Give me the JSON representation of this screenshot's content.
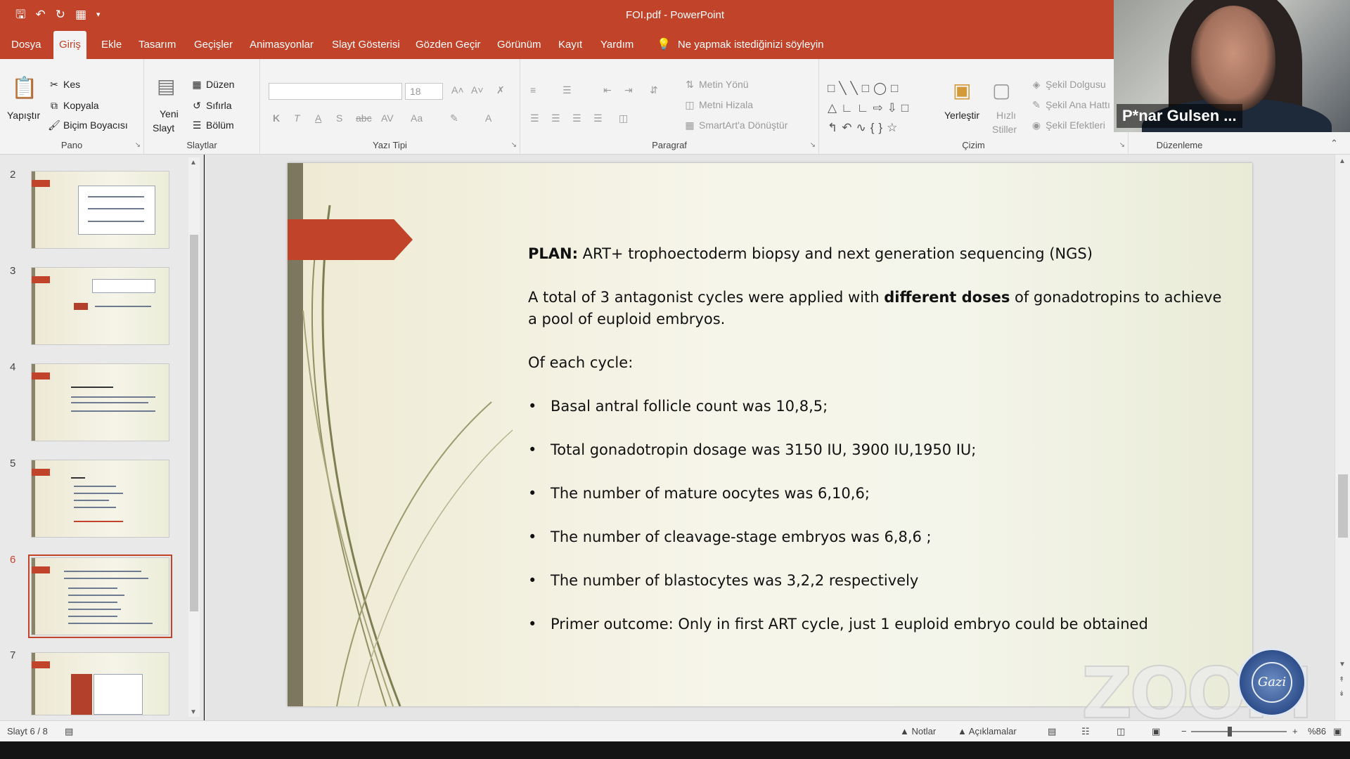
{
  "window": {
    "title": "FOI.pdf  -  PowerPoint",
    "qat_icons": [
      "save-icon",
      "undo-icon",
      "redo-icon",
      "present-icon",
      "customize-icon"
    ]
  },
  "tabs": [
    "Dosya",
    "Giriş",
    "Ekle",
    "Tasarım",
    "Geçişler",
    "Animasyonlar",
    "Slayt Gösterisi",
    "Gözden Geçir",
    "Görünüm",
    "Kayıt",
    "Yardım"
  ],
  "active_tab": "Giriş",
  "tell_me": "Ne yapmak istediğinizi söyleyin",
  "ribbon": {
    "pano": {
      "label": "Pano",
      "paste": "Yapıştır",
      "cut": "Kes",
      "copy": "Kopyala",
      "format_painter": "Biçim Boyacısı"
    },
    "slaytlar": {
      "label": "Slaytlar",
      "new_slide_line1": "Yeni",
      "new_slide_line2": "Slayt",
      "layout": "Düzen",
      "reset": "Sıfırla",
      "section": "Bölüm"
    },
    "yazi_tipi": {
      "label": "Yazı Tipi",
      "font_size": "18",
      "bold": "K",
      "italic": "T",
      "underline": "A",
      "strike": "S",
      "abc": "abc",
      "spacing": "AV",
      "case": "Aa",
      "color": "A"
    },
    "paragraf": {
      "label": "Paragraf",
      "text_direction": "Metin Yönü",
      "align_text": "Metni Hizala",
      "smartart": "SmartArt'a Dönüştür"
    },
    "cizim": {
      "label": "Çizim",
      "arrange": "Yerleştir",
      "quick_styles_line1": "Hızlı",
      "quick_styles_line2": "Stiller",
      "shape_fill": "Şekil Dolgusu",
      "shape_outline": "Şekil Ana Hattı",
      "shape_effects": "Şekil Efektleri"
    },
    "duzenleme": {
      "label": "Düzenleme"
    }
  },
  "video": {
    "name": "P*nar Gulsen ..."
  },
  "thumbnails": {
    "numbers": [
      "2",
      "3",
      "4",
      "5",
      "6",
      "7"
    ],
    "selected": "6"
  },
  "slide": {
    "plan_label": "PLAN:",
    "plan_text": " ART+ trophoectoderm biopsy and next generation sequencing (NGS)",
    "para1_pre": "A total of 3 antagonist cycles were applied with ",
    "para1_bold": "different doses",
    "para1_post": " of gonadotropins to achieve a pool of euploid embryos.",
    "para2": "Of each cycle:",
    "bullets": [
      "Basal antral follicle count was 10,8,5;",
      "Total gonadotropin dosage was 3150 IU, 3900 IU,1950 IU;",
      "The number of mature oocytes was 6,10,6;",
      "The number of cleavage-stage embryos was 6,8,6 ;",
      "The number of blastocytes was 3,2,2 respectively",
      "Primer outcome: Only in first ART cycle, just 1 euploid embryo could be obtained"
    ]
  },
  "watermark": {
    "zoom": "ZOOM",
    "seal_text": "Gazi"
  },
  "status": {
    "slide_counter": "Slayt 6 / 8",
    "notes": "Notlar",
    "comments": "Açıklamalar",
    "zoom_minus": "−",
    "zoom_plus": "+",
    "zoom_level": "%86"
  },
  "colors": {
    "accent": "#c0432a",
    "ribbon_bg": "#f3f3f3"
  }
}
